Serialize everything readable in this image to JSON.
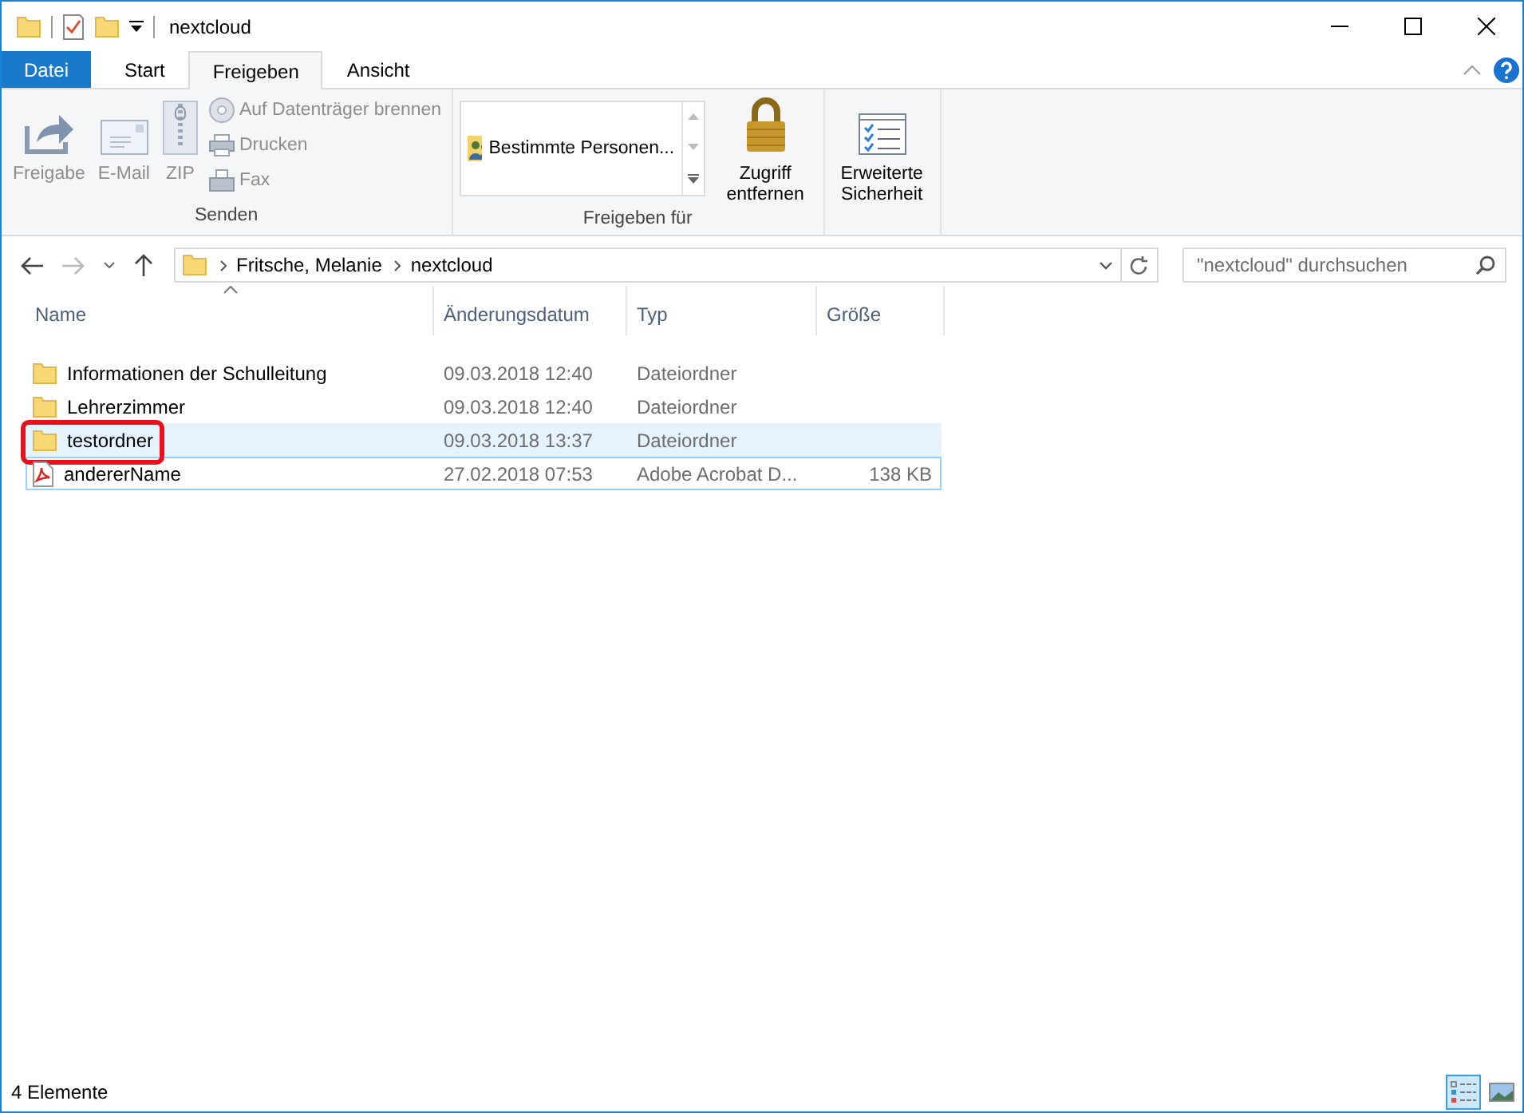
{
  "window": {
    "title": "nextcloud"
  },
  "ribbon_tabs": [
    {
      "label": "Datei",
      "kind": "file",
      "selected": false
    },
    {
      "label": "Start",
      "kind": "tab",
      "selected": false
    },
    {
      "label": "Freigeben",
      "kind": "tab",
      "selected": true
    },
    {
      "label": "Ansicht",
      "kind": "tab",
      "selected": false
    }
  ],
  "ribbon_groups": [
    {
      "label": "Senden",
      "items": [
        {
          "kind": "large",
          "label": "Freigabe",
          "disabled": true
        },
        {
          "kind": "large",
          "label": "E-Mail",
          "disabled": true
        },
        {
          "kind": "large",
          "label": "ZIP",
          "disabled": true
        },
        {
          "kind": "small",
          "label": "Auf Datenträger brennen",
          "disabled": true
        },
        {
          "kind": "small",
          "label": "Drucken",
          "disabled": true
        },
        {
          "kind": "small",
          "label": "Fax",
          "disabled": true
        }
      ]
    },
    {
      "label": "Freigeben für",
      "items": [
        {
          "kind": "gallery",
          "label": "Bestimmte Personen...",
          "disabled": false
        },
        {
          "kind": "large",
          "label": "Zugriff entfernen",
          "disabled": false
        }
      ]
    },
    {
      "items": [
        {
          "kind": "large",
          "label": "Erweiterte Sicherheit",
          "disabled": false
        }
      ]
    }
  ],
  "address": {
    "path": [
      "Fritsche, Melanie",
      "nextcloud"
    ]
  },
  "search": {
    "placeholder": "\"nextcloud\" durchsuchen"
  },
  "columns": [
    {
      "label": "Name",
      "sorted": true
    },
    {
      "label": "Änderungsdatum",
      "sorted": false
    },
    {
      "label": "Typ",
      "sorted": false
    },
    {
      "label": "Größe",
      "sorted": false
    }
  ],
  "rows": [
    {
      "kind": "folder",
      "name": "Informationen der Schulleitung",
      "date": "09.03.2018 12:40",
      "type": "Dateiordner",
      "selected": false,
      "focused": false,
      "highlighted": false
    },
    {
      "kind": "folder",
      "name": "Lehrerzimmer",
      "date": "09.03.2018 12:40",
      "type": "Dateiordner",
      "selected": false,
      "focused": false,
      "highlighted": false
    },
    {
      "kind": "folder",
      "name": "testordner",
      "date": "09.03.2018 13:37",
      "type": "Dateiordner",
      "selected": true,
      "focused": false,
      "highlighted": true
    },
    {
      "kind": "pdf",
      "name": "andererName",
      "date": "27.02.2018 07:53",
      "type": "Adobe Acrobat D...",
      "size": "138 KB",
      "selected": false,
      "focused": true,
      "highlighted": false
    }
  ],
  "status_bar": {
    "text": "4 Elemente"
  },
  "view_buttons": [
    {
      "kind": "details",
      "selected": true
    },
    {
      "kind": "large_icons",
      "selected": false
    }
  ]
}
